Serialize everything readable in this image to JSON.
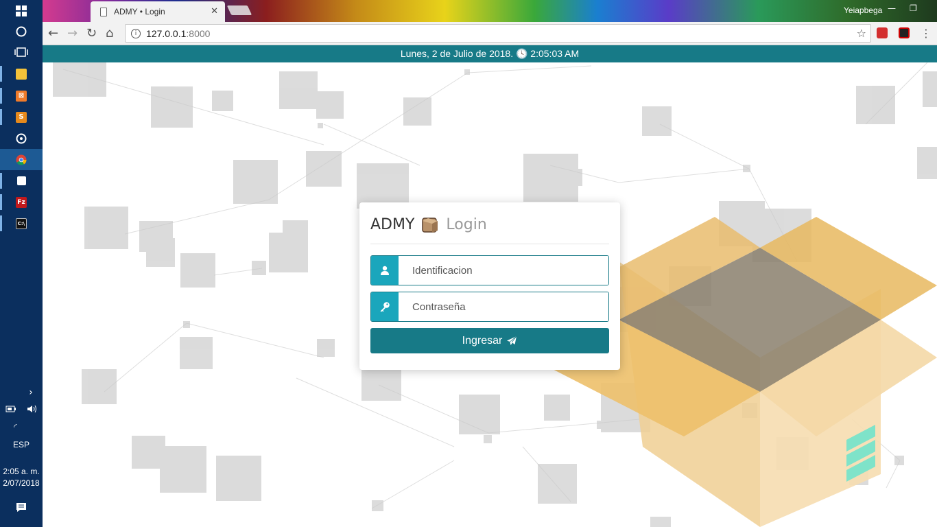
{
  "browser": {
    "tab_title": "ADMY • Login",
    "tab_close": "✕",
    "profile_name": "Yeiapbega",
    "url_host": "127.0.0.1",
    "url_port": ":8000"
  },
  "page": {
    "datetime": "Lunes, 2 de Julio de 2018. 🕓 2:05:03 AM"
  },
  "login": {
    "brand": "ADMY",
    "subtitle": "Login",
    "username_placeholder": "Identificacion",
    "password_placeholder": "Contraseña",
    "submit_label": "Ingresar"
  },
  "taskbar": {
    "language": "ESP",
    "time": "2:05 a. m.",
    "date": "2/07/2018"
  },
  "colors": {
    "teal": "#177a87",
    "addon": "#1aa6bc",
    "taskbar": "#0b2f5e"
  }
}
